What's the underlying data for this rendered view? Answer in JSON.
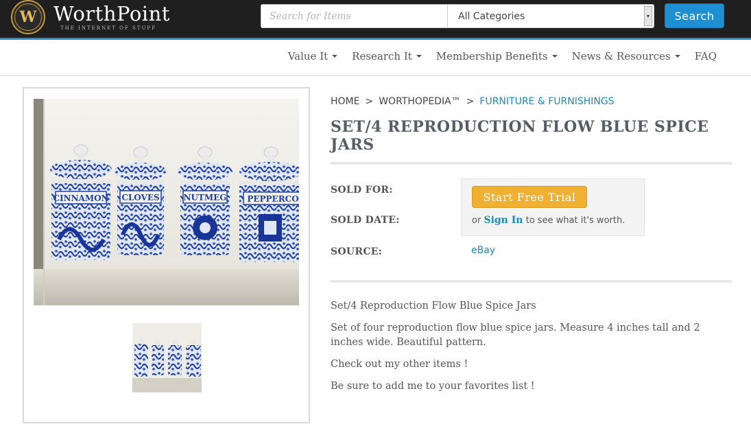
{
  "header": {
    "logo_letter": "W",
    "logo_name": "WorthPoint",
    "logo_tagline": "THE INTERNET OF STUFF",
    "search_placeholder": "Search for Items",
    "category_selected": "All Categories",
    "search_button": "Search"
  },
  "nav": {
    "items": [
      {
        "label": "Value It",
        "dropdown": true
      },
      {
        "label": "Research It",
        "dropdown": true
      },
      {
        "label": "Membership Benefits",
        "dropdown": true
      },
      {
        "label": "News & Resources",
        "dropdown": true
      },
      {
        "label": "FAQ",
        "dropdown": false
      }
    ]
  },
  "breadcrumb": {
    "home": "HOME",
    "sep": ">",
    "worthopedia": "WORTHOPEDIA™",
    "category": "FURNITURE & FURNISHINGS"
  },
  "item": {
    "title": "SET/4 REPRODUCTION FLOW BLUE SPICE JARS",
    "sold_for_label": "SOLD FOR:",
    "sold_date_label": "SOLD DATE:",
    "source_label": "SOURCE:",
    "trial_button": "Start Free Trial",
    "trial_note_pre": "or",
    "sign_in": "Sign In",
    "trial_note_post": "to see what it's worth.",
    "source_value": "eBay",
    "jar_labels": [
      "CINNAMON",
      "CLOVES",
      "NUTMEG",
      "PEPPERCO"
    ],
    "description": [
      "Set/4 Reproduction Flow Blue Spice Jars",
      "Set of four reproduction flow blue spice jars. Measure 4 inches tall and 2 inches wide. Beautiful pattern.",
      "Check out my other items !",
      "Be sure to add me to your favorites list !"
    ]
  },
  "colors": {
    "header_bg": "#1f1f1f",
    "accent_blue": "#1e8fd2",
    "link_blue": "#1a8bb8",
    "trial_orange": "#f0b132",
    "flow_blue": "#1f3fa6"
  }
}
